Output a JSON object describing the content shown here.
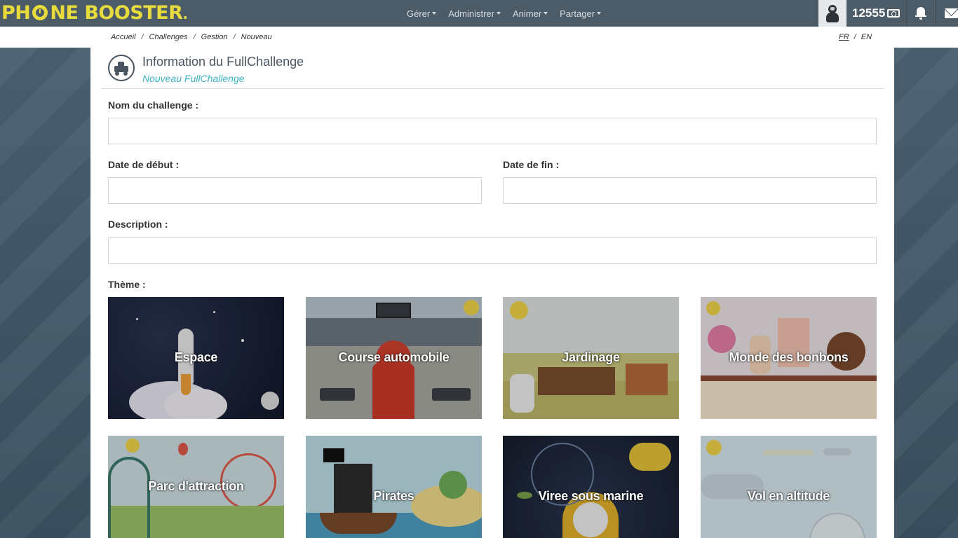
{
  "app": {
    "logo_text_1": "PH",
    "logo_text_2": "NE BOOSTER",
    "logo_dot": "."
  },
  "nav": {
    "items": [
      {
        "label": "Gérer"
      },
      {
        "label": "Administrer"
      },
      {
        "label": "Animer"
      },
      {
        "label": "Partager"
      }
    ]
  },
  "user": {
    "points": "12555",
    "icons": [
      "avatar-icon",
      "money-icon",
      "bell-icon",
      "envelope-icon"
    ]
  },
  "breadcrumb": {
    "items": [
      "Accueil",
      "Challenges",
      "Gestion",
      "Nouveau"
    ],
    "separator": "/"
  },
  "lang": {
    "fr": "FR",
    "en": "EN",
    "separator": "/"
  },
  "card": {
    "title": "Information du FullChallenge",
    "subtitle": "Nouveau FullChallenge"
  },
  "form": {
    "name_label": "Nom du challenge :",
    "name_value": "",
    "start_label": "Date de début :",
    "start_value": "",
    "end_label": "Date de fin :",
    "end_value": "",
    "description_label": "Description :",
    "description_value": "",
    "theme_label": "Thème :"
  },
  "themes": [
    {
      "label": "Espace",
      "color": "#1c2233"
    },
    {
      "label": "Course automobile",
      "color": "#8a9aa4"
    },
    {
      "label": "Jardinage",
      "color": "#a8b48a"
    },
    {
      "label": "Monde des bonbons",
      "color": "#c8a9a9"
    },
    {
      "label": "Parc d'attraction",
      "color": "#8fa8b0"
    },
    {
      "label": "Pirates",
      "color": "#8cb3c0"
    },
    {
      "label": "Viree sous marine",
      "color": "#1f2838"
    },
    {
      "label": "Vol en altitude",
      "color": "#9cb8c6"
    }
  ],
  "colors": {
    "topbar": "#4c5b68",
    "logo": "#e8dc3c",
    "accent": "#3fb3c3",
    "title": "#4a5561"
  }
}
